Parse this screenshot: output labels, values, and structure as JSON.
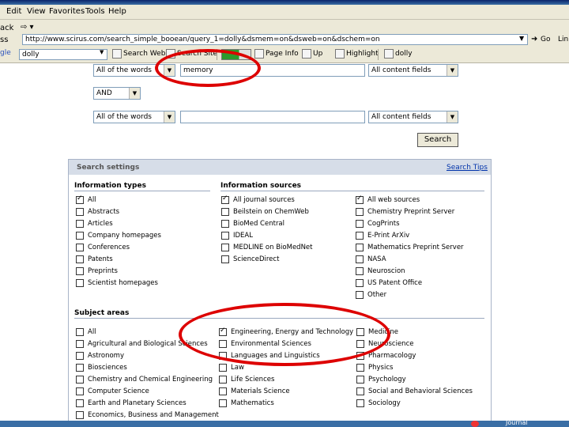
{
  "menu": [
    "Edit",
    "View",
    "Favorites",
    "Tools",
    "Help"
  ],
  "address": {
    "back_label": "ack",
    "label": "ss",
    "url": "http://www.scirus.com/search_simple_booean/query_1=dolly&dsmem=on&dsweb=on&dschem=on",
    "go_label": "Go",
    "links_label": "Lin"
  },
  "google": {
    "prefix": "gle",
    "query": "dolly",
    "search_web": "Search Web",
    "search_site": "Search Site",
    "page_info": "Page Info",
    "up": "Up",
    "highlight": "Highlight",
    "term": "dolly"
  },
  "form": {
    "row1": {
      "scope": "All of the words",
      "value": "memory",
      "fields": "All content fields"
    },
    "op": "AND",
    "row2": {
      "scope": "All of the words",
      "value": "",
      "fields": "All content fields"
    },
    "search_label": "Search"
  },
  "settings": {
    "title": "Search settings",
    "tips": "Search Tips",
    "info_types_title": "Information types",
    "info_sources_title": "Information sources",
    "subject_title": "Subject areas",
    "info_types": [
      {
        "label": "All",
        "checked": true
      },
      {
        "label": "Abstracts",
        "checked": false
      },
      {
        "label": "Articles",
        "checked": false
      },
      {
        "label": "Company homepages",
        "checked": false
      },
      {
        "label": "Conferences",
        "checked": false
      },
      {
        "label": "Patents",
        "checked": false
      },
      {
        "label": "Preprints",
        "checked": false
      },
      {
        "label": "Scientist homepages",
        "checked": false
      }
    ],
    "sources_col1": [
      {
        "label": "All journal sources",
        "checked": true
      },
      {
        "label": "Beilstein on ChemWeb",
        "checked": false
      },
      {
        "label": "BioMed Central",
        "checked": false
      },
      {
        "label": "IDEAL",
        "checked": false
      },
      {
        "label": "MEDLINE on BioMedNet",
        "checked": false
      },
      {
        "label": "ScienceDirect",
        "checked": false
      }
    ],
    "sources_col2": [
      {
        "label": "All web sources",
        "checked": true
      },
      {
        "label": "Chemistry Preprint Server",
        "checked": false
      },
      {
        "label": "CogPrints",
        "checked": false
      },
      {
        "label": "E-Print ArXiv",
        "checked": false
      },
      {
        "label": "Mathematics Preprint Server",
        "checked": false
      },
      {
        "label": "NASA",
        "checked": false
      },
      {
        "label": "Neuroscion",
        "checked": false
      },
      {
        "label": "US Patent Office",
        "checked": false
      },
      {
        "label": "Other",
        "checked": false
      }
    ],
    "subjects_col1": [
      {
        "label": "All",
        "checked": false
      },
      {
        "label": "Agricultural and Biological Sciences",
        "checked": false
      },
      {
        "label": "Astronomy",
        "checked": false
      },
      {
        "label": "Biosciences",
        "checked": false
      },
      {
        "label": "Chemistry and Chemical Engineering",
        "checked": false
      },
      {
        "label": "Computer Science",
        "checked": false
      },
      {
        "label": "Earth and Planetary Sciences",
        "checked": false
      },
      {
        "label": "Economics, Business and Management",
        "checked": false
      }
    ],
    "subjects_col2": [
      {
        "label": "Engineering, Energy and Technology",
        "checked": true
      },
      {
        "label": "Environmental Sciences",
        "checked": false
      },
      {
        "label": "Languages and Linguistics",
        "checked": false
      },
      {
        "label": "Law",
        "checked": false
      },
      {
        "label": "Life Sciences",
        "checked": false
      },
      {
        "label": "Materials Science",
        "checked": false
      },
      {
        "label": "Mathematics",
        "checked": false
      }
    ],
    "subjects_col3": [
      {
        "label": "Medicine",
        "checked": false
      },
      {
        "label": "Neuroscience",
        "checked": false
      },
      {
        "label": "Pharmacology",
        "checked": false
      },
      {
        "label": "Physics",
        "checked": false
      },
      {
        "label": "Psychology",
        "checked": false
      },
      {
        "label": "Social and Behavioral Sciences",
        "checked": false
      },
      {
        "label": "Sociology",
        "checked": false
      }
    ]
  },
  "taskbar": {
    "item": "Journal"
  },
  "colors": {
    "annotation": "#dd0000",
    "panel_header": "#d6dde8",
    "link": "#0033aa"
  }
}
